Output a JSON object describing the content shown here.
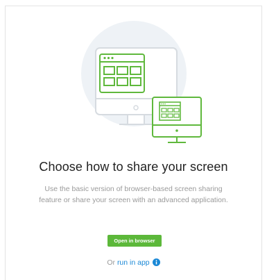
{
  "dialog": {
    "title": "Choose how to share your screen",
    "description": "Use the basic version of browser-based screen sharing feature or share your screen with an advanced application.",
    "open_button_label": "Open in browser",
    "or_prefix": "Or",
    "run_link_label": "run in app"
  },
  "icons": {
    "illustration": "monitor-with-browser-windows-illustration",
    "info": "info-icon"
  },
  "colors": {
    "accent_green": "#5cb83a",
    "link_blue": "#1a88d6",
    "illustration_green": "#5fb83c",
    "illustration_gray": "#d6dbe0",
    "circle_bg": "#eef2f6"
  }
}
